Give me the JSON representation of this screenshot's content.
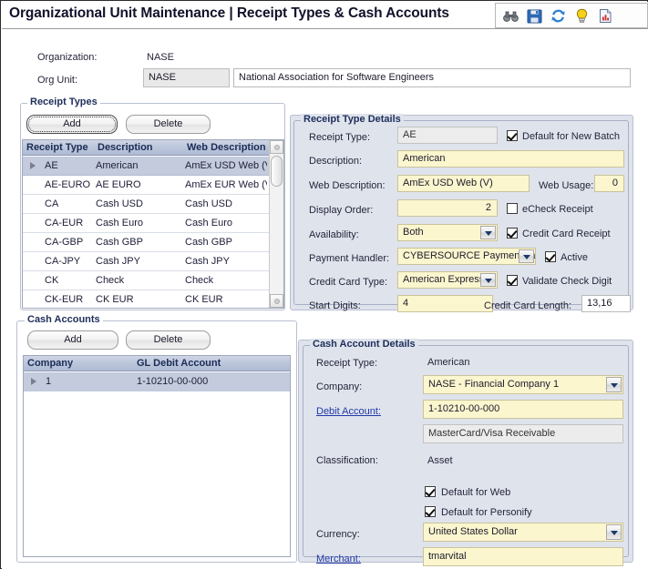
{
  "window": {
    "title": "Organizational Unit Maintenance | Receipt Types & Cash Accounts"
  },
  "toolbar": {
    "icons": [
      {
        "name": "binoculars-icon",
        "title": "Search"
      },
      {
        "name": "save-icon",
        "title": "Save"
      },
      {
        "name": "refresh-icon",
        "title": "Refresh"
      },
      {
        "name": "lightbulb-icon",
        "title": "Hints"
      },
      {
        "name": "report-icon",
        "title": "Report"
      }
    ]
  },
  "header": {
    "organization_label": "Organization:",
    "organization_value": "NASE",
    "org_unit_label": "Org Unit:",
    "org_unit_code": "NASE",
    "org_unit_name": "National Association for Software Engineers"
  },
  "receipt_types": {
    "group_title": "Receipt Types",
    "add_label": "Add",
    "delete_label": "Delete",
    "columns": [
      "Receipt Type",
      "Description",
      "Web Description"
    ],
    "rows": [
      {
        "type": "AE",
        "description": "American",
        "web_description": "AmEx USD Web (V",
        "selected": true
      },
      {
        "type": "AE-EURO",
        "description": "AE EURO",
        "web_description": "AmEx EUR Web (V",
        "selected": false
      },
      {
        "type": "CA",
        "description": "Cash USD",
        "web_description": "Cash USD",
        "selected": false
      },
      {
        "type": "CA-EUR",
        "description": "Cash  Euro",
        "web_description": "Cash  Euro",
        "selected": false
      },
      {
        "type": "CA-GBP",
        "description": "Cash GBP",
        "web_description": "Cash GBP",
        "selected": false
      },
      {
        "type": "CA-JPY",
        "description": "Cash JPY",
        "web_description": "Cash JPY",
        "selected": false
      },
      {
        "type": "CK",
        "description": "Check",
        "web_description": "Check",
        "selected": false
      },
      {
        "type": "CK-EUR",
        "description": "CK EUR",
        "web_description": "CK EUR",
        "selected": false
      }
    ]
  },
  "receipt_type_details": {
    "group_title": "Receipt Type Details",
    "receipt_type_label": "Receipt Type:",
    "receipt_type_value": "AE",
    "default_for_new_batch_label": "Default for New Batch",
    "default_for_new_batch_checked": true,
    "description_label": "Description:",
    "description_value": "American",
    "web_description_label": "Web Description:",
    "web_description_value": "AmEx USD Web (V)",
    "web_usage_label": "Web Usage:",
    "web_usage_value": "0",
    "display_order_label": "Display Order:",
    "display_order_value": "2",
    "echeck_receipt_label": "eCheck Receipt",
    "echeck_receipt_checked": false,
    "availability_label": "Availability:",
    "availability_value": "Both",
    "credit_card_receipt_label": "Credit Card Receipt",
    "credit_card_receipt_checked": true,
    "payment_handler_label": "Payment Handler:",
    "payment_handler_value": "CYBERSOURCE PaymentHa",
    "active_label": "Active",
    "active_checked": true,
    "credit_card_type_label": "Credit Card Type:",
    "credit_card_type_value": "American Express",
    "validate_check_digit_label": "Validate Check Digit",
    "validate_check_digit_checked": true,
    "start_digits_label": "Start Digits:",
    "start_digits_value": "4",
    "credit_card_length_label": "Credit Card Length:",
    "credit_card_length_value": "13,16"
  },
  "cash_accounts": {
    "group_title": "Cash Accounts",
    "add_label": "Add",
    "delete_label": "Delete",
    "columns": [
      "Company",
      "GL Debit Account"
    ],
    "rows": [
      {
        "company": "1",
        "gl_debit_account": "1-10210-00-000",
        "selected": true
      }
    ]
  },
  "cash_account_details": {
    "group_title": "Cash Account Details",
    "receipt_type_label": "Receipt Type:",
    "receipt_type_value": "American",
    "company_label": "Company:",
    "company_value": "NASE - Financial Company 1",
    "debit_account_label": "Debit Account:",
    "debit_account_value": "1-10210-00-000",
    "debit_account_description": "MasterCard/Visa Receivable",
    "classification_label": "Classification:",
    "classification_value": "Asset",
    "default_for_web_label": "Default for Web",
    "default_for_web_checked": true,
    "default_for_personify_label": "Default for Personify",
    "default_for_personify_checked": true,
    "currency_label": "Currency:",
    "currency_value": "United States Dollar",
    "merchant_label": "Merchant:",
    "merchant_value": "tmarvital"
  },
  "colors": {
    "accent": "#20305c",
    "panel": "#dfe3ec",
    "field_editable": "#fcf6cf",
    "grid_header": "#bcc6db",
    "grid_selected_row": "#c3cbdd",
    "link": "#2138a8"
  }
}
